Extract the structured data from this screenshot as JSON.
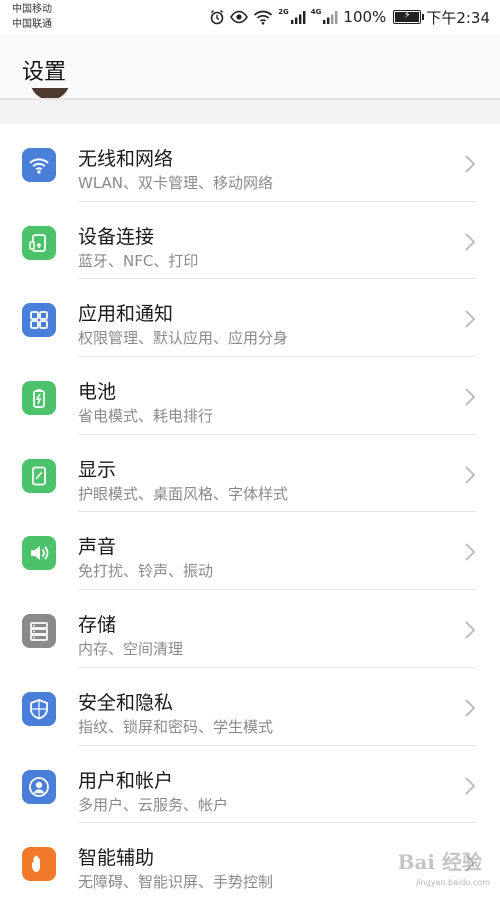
{
  "status_bar": {
    "carrier_1": "中国移动",
    "carrier_2": "中国联通",
    "signal_1_label": "2G",
    "signal_2_label": "4G",
    "battery_percent": "100%",
    "battery_level": 1.0,
    "time": "下午2:34",
    "icons": [
      "alarm-icon",
      "eye-icon",
      "wifi-icon",
      "signal-icon",
      "signal-icon",
      "battery-charging-icon"
    ]
  },
  "header": {
    "title": "设置"
  },
  "settings": [
    {
      "title": "无线和网络",
      "subtitle": "WLAN、双卡管理、移动网络",
      "icon": "wifi-icon",
      "color": "#4a7fd9"
    },
    {
      "title": "设备连接",
      "subtitle": "蓝牙、NFC、打印",
      "icon": "device-connect-icon",
      "color": "#4cc36a"
    },
    {
      "title": "应用和通知",
      "subtitle": "权限管理、默认应用、应用分身",
      "icon": "apps-grid-icon",
      "color": "#4a7fd9"
    },
    {
      "title": "电池",
      "subtitle": "省电模式、耗电排行",
      "icon": "battery-icon",
      "color": "#4cc36a"
    },
    {
      "title": "显示",
      "subtitle": "护眼模式、桌面风格、字体样式",
      "icon": "display-icon",
      "color": "#4cc36a"
    },
    {
      "title": "声音",
      "subtitle": "免打扰、铃声、振动",
      "icon": "speaker-icon",
      "color": "#4cc36a"
    },
    {
      "title": "存储",
      "subtitle": "内存、空间清理",
      "icon": "storage-icon",
      "color": "#8a8a8a"
    },
    {
      "title": "安全和隐私",
      "subtitle": "指纹、锁屏和密码、学生模式",
      "icon": "shield-icon",
      "color": "#4a7fd9"
    },
    {
      "title": "用户和帐户",
      "subtitle": "多用户、云服务、帐户",
      "icon": "user-icon",
      "color": "#4a7fd9"
    },
    {
      "title": "智能辅助",
      "subtitle": "无障碍、智能识屏、手势控制",
      "icon": "hand-icon",
      "color": "#f07a2a"
    }
  ],
  "watermark": {
    "text": "Bai 经验",
    "sub": "jingyan.baidu.com"
  }
}
